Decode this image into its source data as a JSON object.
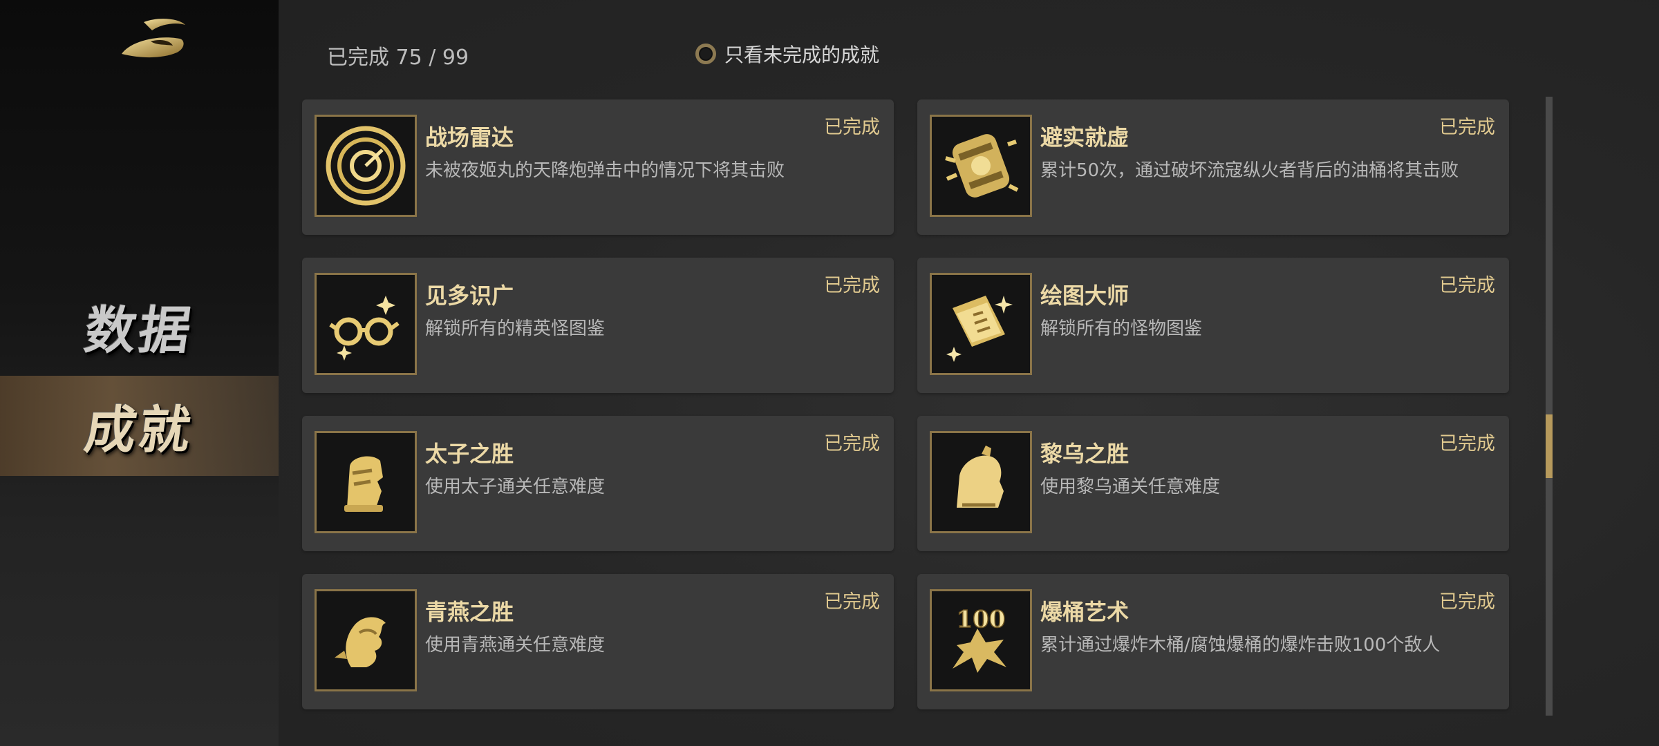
{
  "sidebar": {
    "items": [
      {
        "label": "数据",
        "active": false
      },
      {
        "label": "成就",
        "active": true
      }
    ]
  },
  "header": {
    "progress_text": "已完成 75 / 99",
    "filter_label": "只看未完成的成就"
  },
  "achievements": [
    {
      "title": "战场雷达",
      "desc": "未被夜姬丸的天降炮弹击中的情况下将其击败",
      "status": "已完成",
      "icon": "radar-icon"
    },
    {
      "title": "避实就虚",
      "desc": "累计50次，通过破坏流寇纵火者背后的油桶将其击败",
      "status": "已完成",
      "icon": "barrel-icon"
    },
    {
      "title": "见多识广",
      "desc": "解锁所有的精英怪图鉴",
      "status": "已完成",
      "icon": "glasses-icon"
    },
    {
      "title": "绘图大师",
      "desc": "解锁所有的怪物图鉴",
      "status": "已完成",
      "icon": "book-icon"
    },
    {
      "title": "太子之胜",
      "desc": "使用太子通关任意难度",
      "status": "已完成",
      "icon": "character-head-icon"
    },
    {
      "title": "黎乌之胜",
      "desc": "使用黎乌通关任意难度",
      "status": "已完成",
      "icon": "helmet-icon"
    },
    {
      "title": "青燕之胜",
      "desc": "使用青燕通关任意难度",
      "status": "已完成",
      "icon": "swallow-head-icon"
    },
    {
      "title": "爆桶艺术",
      "desc": "累计通过爆炸木桶/腐蚀爆桶的爆炸击败100个敌人",
      "status": "已完成",
      "icon": "explosion-100-icon"
    }
  ],
  "colors": {
    "accent_gold": "#e0c98f",
    "card_bg": "#3a3a3a",
    "sidebar_active": "#6c563c"
  }
}
